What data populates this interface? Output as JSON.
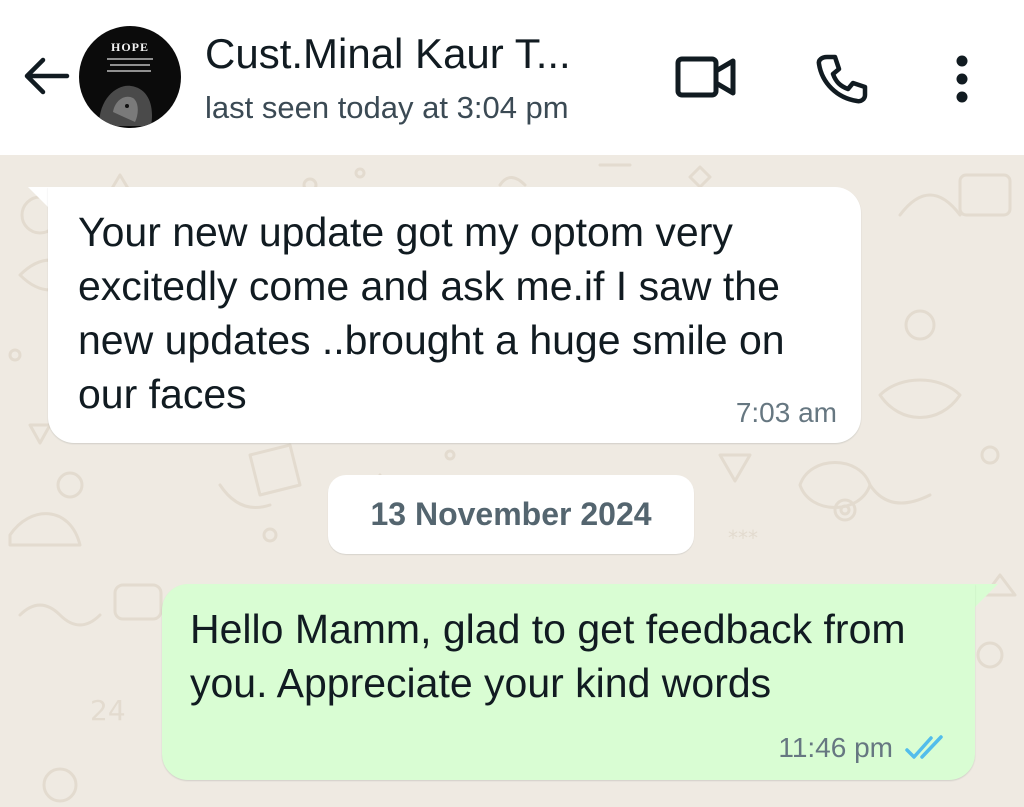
{
  "header": {
    "contact_name": "Cust.Minal Kaur T...",
    "last_seen": "last seen today at 3:04 pm",
    "avatar_text": "HOPE",
    "icons": {
      "back": "arrow-left-icon",
      "video": "video-camera-icon",
      "call": "phone-icon",
      "menu": "more-vertical-icon"
    }
  },
  "messages": [
    {
      "direction": "incoming",
      "text": "Your new update got my optom very excitedly come and ask me.if I saw the new updates ..brought a huge smile on our faces",
      "time": "7:03 am"
    },
    {
      "direction": "outgoing",
      "text": "Hello Mamm, glad to get feedback from you. Appreciate your kind words",
      "time": "11:46 pm",
      "status": "read"
    }
  ],
  "date_separator": "13 November 2024",
  "colors": {
    "wallpaper": "#efeae2",
    "incoming_bubble": "#ffffff",
    "outgoing_bubble": "#d9fdd3",
    "read_ticks": "#53bdeb"
  }
}
